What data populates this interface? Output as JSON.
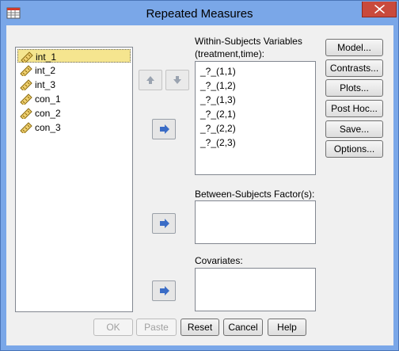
{
  "window": {
    "title": "Repeated Measures"
  },
  "variables": [
    "int_1",
    "int_2",
    "int_3",
    "con_1",
    "con_2",
    "con_3"
  ],
  "within": {
    "label": "Within-Subjects Variables",
    "sublabel": "(treatment,time):",
    "items": [
      "_?_(1,1)",
      "_?_(1,2)",
      "_?_(1,3)",
      "_?_(2,1)",
      "_?_(2,2)",
      "_?_(2,3)"
    ]
  },
  "between": {
    "label": "Between-Subjects Factor(s):"
  },
  "covariates": {
    "label": "Covariates:"
  },
  "side_buttons": {
    "model": "Model...",
    "contrasts": "Contrasts...",
    "plots": "Plots...",
    "posthoc": "Post Hoc...",
    "save": "Save...",
    "options": "Options..."
  },
  "bottom_buttons": {
    "ok": "OK",
    "paste": "Paste",
    "reset": "Reset",
    "cancel": "Cancel",
    "help": "Help"
  },
  "colors": {
    "selection": "#f5e58f",
    "arrow": "#3a6cc6",
    "chrome": "#7aa7e8"
  }
}
